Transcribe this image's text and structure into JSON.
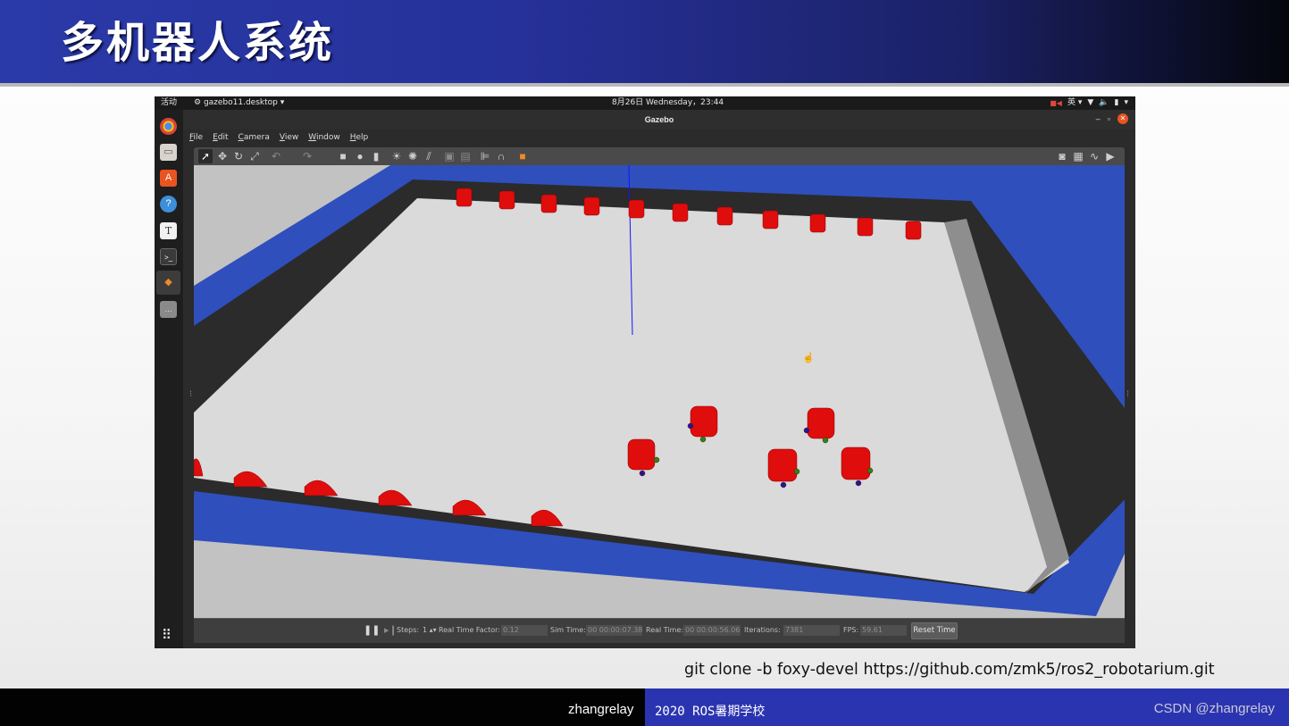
{
  "slide": {
    "title": "多机器人系统",
    "caption": "git clone -b foxy-devel https://github.com/zmk5/ros2_robotarium.git",
    "footer_author": "zhangrelay",
    "footer_event": "2020 ROS暑期学校",
    "footer_watermark": "CSDN @zhangrelay"
  },
  "desktop": {
    "activities": "活动",
    "app_menu": "gazebo11.desktop",
    "clock": "8月26日 Wednesday，23:44",
    "input_method": "英",
    "dock_items": [
      "chrome-icon",
      "files-icon",
      "software-center-icon",
      "help-icon",
      "text-editor-icon",
      "terminal-icon",
      "gazebo-icon",
      "apps-icon"
    ]
  },
  "window": {
    "title": "Gazebo",
    "menus": [
      "File",
      "Edit",
      "Camera",
      "View",
      "Window",
      "Help"
    ]
  },
  "toolbar": {
    "tools": [
      "select-icon",
      "translate-icon",
      "rotate-icon",
      "scale-icon",
      "undo-icon",
      "redo-icon",
      "box-icon",
      "sphere-icon",
      "cylinder-icon",
      "point-light-icon",
      "spot-light-icon",
      "directional-light-icon",
      "copy-icon",
      "paste-icon",
      "align-icon",
      "snap-icon",
      "change-view-icon"
    ],
    "right_tools": [
      "screenshot-icon",
      "log-icon",
      "plot-icon",
      "video-icon"
    ]
  },
  "status": {
    "steps_label": "Steps:",
    "steps_value": "1",
    "rtf_label": "Real Time Factor:",
    "rtf_value": "0.12",
    "sim_time_label": "Sim Time:",
    "sim_time_value": "00 00:00:07.381",
    "real_time_label": "Real Time:",
    "real_time_value": "00 00:00:56.065",
    "iterations_label": "Iterations:",
    "iterations_value": "7381",
    "fps_label": "FPS:",
    "fps_value": "59.61",
    "reset_label": "Reset Time"
  },
  "colors": {
    "header": "#2a3aa8",
    "arena_wall": "#2d4dbb",
    "robot": "#e01010",
    "footer_blue": "#2b34b0"
  }
}
